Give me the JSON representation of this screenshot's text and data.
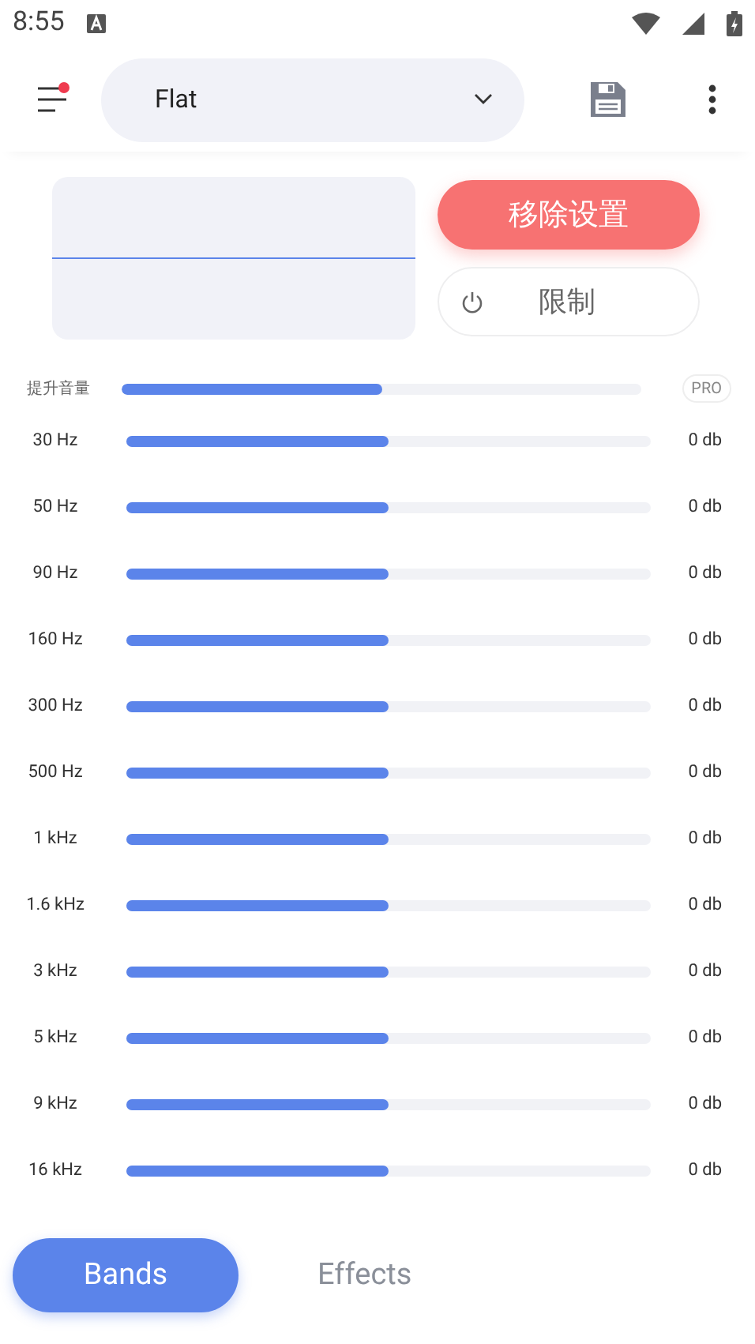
{
  "status_bar": {
    "time": "8:55"
  },
  "toolbar": {
    "preset": "Flat",
    "menu_badge": true
  },
  "actions": {
    "reset": "移除设置",
    "limit": "限制",
    "limit_on": false
  },
  "boost": {
    "label": "提升音量",
    "level": 0.5,
    "badge": "PRO"
  },
  "bands": [
    {
      "freq": "30 Hz",
      "level": 0.5,
      "reading": "0 db"
    },
    {
      "freq": "50 Hz",
      "level": 0.5,
      "reading": "0 db"
    },
    {
      "freq": "90 Hz",
      "level": 0.5,
      "reading": "0 db"
    },
    {
      "freq": "160 Hz",
      "level": 0.5,
      "reading": "0 db"
    },
    {
      "freq": "300 Hz",
      "level": 0.5,
      "reading": "0 db"
    },
    {
      "freq": "500 Hz",
      "level": 0.5,
      "reading": "0 db"
    },
    {
      "freq": "1 kHz",
      "level": 0.5,
      "reading": "0 db"
    },
    {
      "freq": "1.6 kHz",
      "level": 0.5,
      "reading": "0 db"
    },
    {
      "freq": "3 kHz",
      "level": 0.5,
      "reading": "0 db"
    },
    {
      "freq": "5 kHz",
      "level": 0.5,
      "reading": "0 db"
    },
    {
      "freq": "9 kHz",
      "level": 0.5,
      "reading": "0 db"
    },
    {
      "freq": "16 kHz",
      "level": 0.5,
      "reading": "0 db"
    }
  ],
  "tabs": [
    {
      "label": "Bands",
      "selected": true
    },
    {
      "label": "Effects",
      "selected": false
    }
  ]
}
